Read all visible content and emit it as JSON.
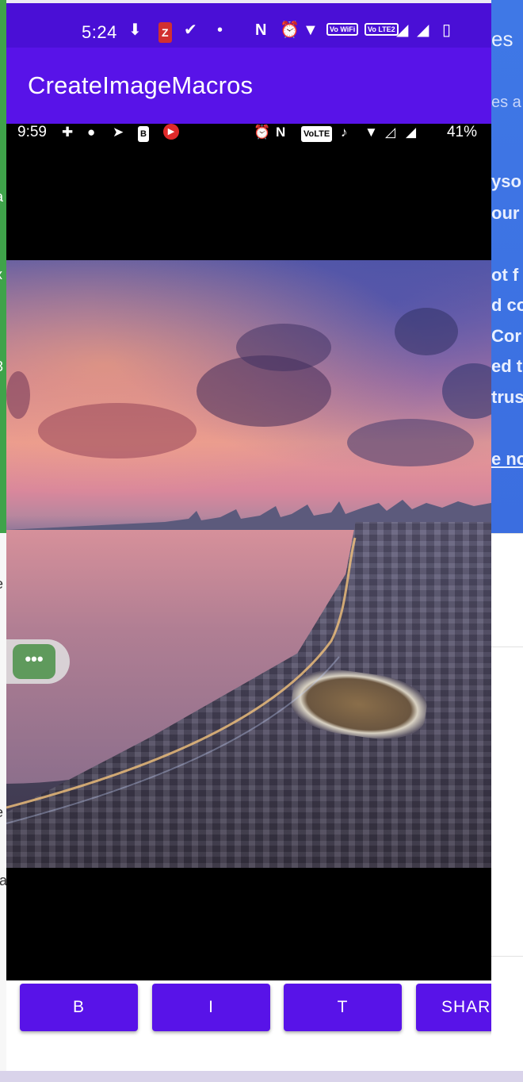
{
  "background_app": {
    "right_lines": [
      "es",
      "es a",
      "yso",
      "our",
      "ot f",
      "d co",
      "Cor",
      "ed to",
      "trus",
      "e no"
    ],
    "left_lines": [
      "a",
      "x",
      "3",
      "e",
      "r",
      "e",
      "ta",
      "("
    ]
  },
  "device_status_bar": {
    "time": "5:24",
    "icons": [
      "location-pin-icon",
      "zomato-z-icon",
      "check-circle-icon",
      "dot-icon",
      "nfc-icon",
      "alarm-icon",
      "wifi-icon",
      "vowifi-icon",
      "volte2-icon",
      "signal-icon",
      "signal-icon",
      "battery-icon"
    ],
    "z_label": "Z",
    "vowifi_label": "Vo WiFi",
    "volte_label": "Vo LTE2"
  },
  "app_bar": {
    "title": "CreateImageMacros"
  },
  "inner_status_bar": {
    "time": "9:59",
    "volte_label": "VoLTE",
    "b_label": "B",
    "battery": "41%"
  },
  "floating_bubble": {
    "label": "•••"
  },
  "buttons": [
    {
      "label": "B"
    },
    {
      "label": "I"
    },
    {
      "label": "T"
    },
    {
      "label": "SHAR"
    }
  ],
  "colors": {
    "status_bar": "#4a0fd6",
    "app_bar": "#5813e8",
    "button": "#5813e8"
  }
}
